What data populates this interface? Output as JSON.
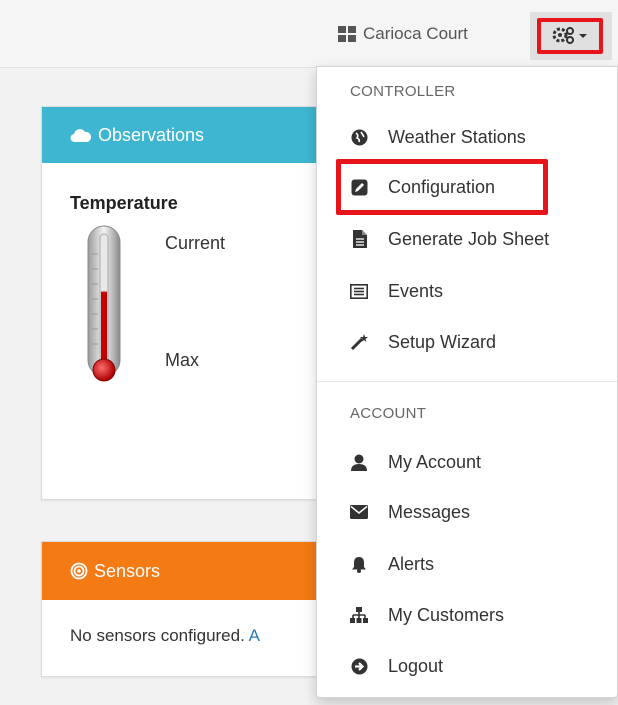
{
  "navbar": {
    "site_name": "Carioca Court",
    "settings_icon": "gears-icon"
  },
  "observations": {
    "title": "Observations",
    "temperature_label": "Temperature",
    "current_label": "Current",
    "max_label": "Max",
    "thermometer_fill": 0.55
  },
  "sensors": {
    "title": "Sensors",
    "message": "No sensors configured.",
    "link_text": "A"
  },
  "menu": {
    "controller_header": "CONTROLLER",
    "controller_items": [
      {
        "label": "Weather Stations",
        "icon": "globe-icon"
      },
      {
        "label": "Configuration",
        "icon": "edit-icon"
      },
      {
        "label": "Generate Job Sheet",
        "icon": "file-icon"
      },
      {
        "label": "Events",
        "icon": "list-icon"
      },
      {
        "label": "Setup Wizard",
        "icon": "magic-wand-icon"
      }
    ],
    "account_header": "ACCOUNT",
    "account_items": [
      {
        "label": "My Account",
        "icon": "user-icon"
      },
      {
        "label": "Messages",
        "icon": "envelope-icon"
      },
      {
        "label": "Alerts",
        "icon": "bell-icon"
      },
      {
        "label": "My Customers",
        "icon": "sitemap-icon"
      },
      {
        "label": "Logout",
        "icon": "circle-arrow-right-icon"
      }
    ]
  },
  "colors": {
    "observations_header": "#3fb6d1",
    "sensors_header": "#f47a14",
    "highlight": "#e8141c"
  }
}
